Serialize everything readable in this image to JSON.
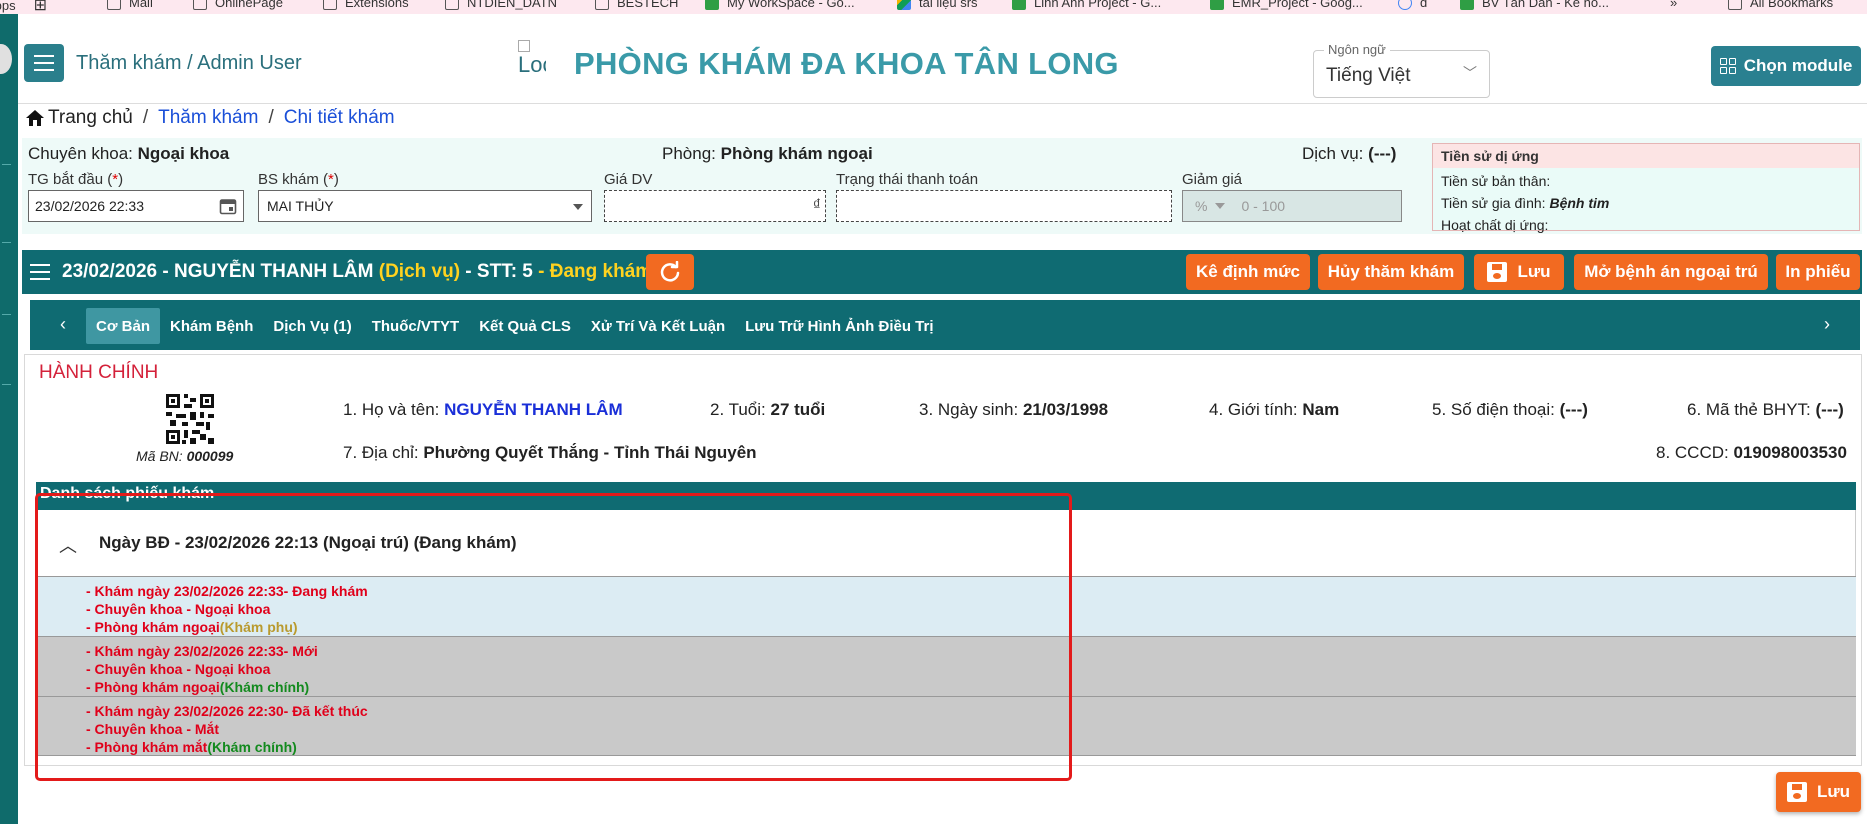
{
  "bookmarks": [
    {
      "label": "Apps",
      "icon": "apps-icon"
    },
    {
      "label": "Mail",
      "icon": "folder-icon"
    },
    {
      "label": "OnlinePage",
      "icon": "folder-icon"
    },
    {
      "label": "Extensions",
      "icon": "folder-icon"
    },
    {
      "label": "NTDIEN_DATN",
      "icon": "folder-icon"
    },
    {
      "label": "BESTECH",
      "icon": "folder-icon"
    },
    {
      "label": "My WorkSpace - Go...",
      "icon": "sheets-icon"
    },
    {
      "label": "tài liệu srs",
      "icon": "drive-icon"
    },
    {
      "label": "Linh Anh Project - G...",
      "icon": "sheets-icon"
    },
    {
      "label": "EMR_Project - Goog...",
      "icon": "sheets-icon"
    },
    {
      "label": "đ",
      "icon": "chrome-icon"
    },
    {
      "label": "BV Tân Dân - Kế ho...",
      "icon": "sheets-icon"
    },
    {
      "label": "»",
      "icon": ""
    },
    {
      "label": "All Bookmarks",
      "icon": "folder-icon"
    }
  ],
  "header": {
    "module_title": "Thăm khám / Admin User",
    "logo_alt": "Loc",
    "clinic_name": "PHÒNG KHÁM ĐA KHOA TÂN LONG",
    "language_label": "Ngôn ngữ",
    "language_value": "Tiếng Việt",
    "module_button": "Chọn module"
  },
  "breadcrumb": {
    "home": "Trang chủ",
    "sep": "/",
    "level1": "Thăm khám",
    "level2": "Chi tiết khám"
  },
  "info": {
    "specialty_label": "Chuyên khoa:",
    "specialty_value": "Ngoại khoa",
    "room_label": "Phòng:",
    "room_value": "Phòng khám ngoại",
    "service_label": "Dịch vụ:",
    "service_value": "(---)",
    "start_time_label": "TG bắt đầu (",
    "start_time_value": "23/02/2026 22:33",
    "doctor_label": "BS khám (",
    "doctor_value": "MAI THỦY",
    "req_mark": "*",
    "req_close": ")",
    "price_label": "Giá DV",
    "price_currency": "₫",
    "payment_label": "Trạng thái thanh toán",
    "discount_label": "Giảm giá",
    "discount_unit": "%",
    "discount_placeholder": "0 - 100"
  },
  "allergy": {
    "title": "Tiền sử dị ứng",
    "self_label": "Tiền sử bản thân:",
    "family_label": "Tiền sử gia đình:",
    "family_value": "Bệnh tim",
    "substance_label": "Hoạt chất dị ứng:"
  },
  "patient_bar": {
    "date_name": "23/02/2026 - NGUYỄN THANH LÂM ",
    "service_tag": "(Dịch vụ)",
    "stt": " - STT: 5 ",
    "status": "- Đang khám",
    "buttons": {
      "ke_dinh_muc": "Kê định mức",
      "huy_tham_kham": "Hủy thăm khám",
      "luu": "Lưu",
      "mo_benh_an": "Mở bệnh án ngoại trú",
      "in_phieu": "In phiếu"
    }
  },
  "tabs": [
    "Cơ Bản",
    "Khám Bệnh",
    "Dịch Vụ (1)",
    "Thuốc/VTYT",
    "Kết Quả CLS",
    "Xử Trí Và Kết Luận",
    "Lưu Trữ Hình Ảnh Điều Trị"
  ],
  "hanh_chinh": {
    "title": "HÀNH CHÍNH",
    "ma_bn_label": "Mã BN:",
    "ma_bn_value": "000099",
    "name_label": "1. Họ và tên:",
    "name_value": "NGUYỄN THANH LÂM",
    "age_label": "2. Tuổi:",
    "age_value": "27 tuổi",
    "dob_label": "3. Ngày sinh:",
    "dob_value": "21/03/1998",
    "gender_label": "4. Giới tính:",
    "gender_value": "Nam",
    "phone_label": "5. Số điện thoại:",
    "phone_value": "(---)",
    "bhyt_label": "6. Mã thẻ BHYT:",
    "bhyt_value": "(---)",
    "address_label": "7. Địa chỉ:",
    "address_value": "Phường Quyết Thắng - Tỉnh Thái Nguyên",
    "cccd_label": "8. CCCD:",
    "cccd_value": "019098003530"
  },
  "ds_phieu_kham": {
    "header": "Danh sách phiếu khám",
    "group_title": "Ngày BĐ - 23/02/2026 22:13 (Ngoại trú) (Đang khám)",
    "items": [
      {
        "line1": "- Khám ngày 23/02/2026 22:33- Đang khám",
        "line2": "- Chuyên khoa - Ngoại khoa",
        "line3": "- Phòng khám ngoại",
        "tag": "(Khám phụ)",
        "bg": "#dcecf3",
        "tag_color": "gold"
      },
      {
        "line1": "- Khám ngày 23/02/2026 22:33- Mới",
        "line2": "- Chuyên khoa - Ngoại khoa",
        "line3": "- Phòng khám ngoại",
        "tag": "(Khám chính)",
        "bg": "#c9c9c9",
        "tag_color": "green"
      },
      {
        "line1": "- Khám ngày 23/02/2026 22:30- Đã kết thúc",
        "line2": "- Chuyên khoa - Mắt",
        "line3": "- Phòng khám mắt",
        "tag": "(Khám chính)",
        "bg": "#c9c9c9",
        "tag_color": "green"
      }
    ]
  },
  "bottom_save": "Lưu",
  "colors": {
    "teal_dark": "#0f6b72",
    "orange": "#f26a21",
    "red_title": "#d4213a",
    "highlight_box": "#e31a1a"
  }
}
